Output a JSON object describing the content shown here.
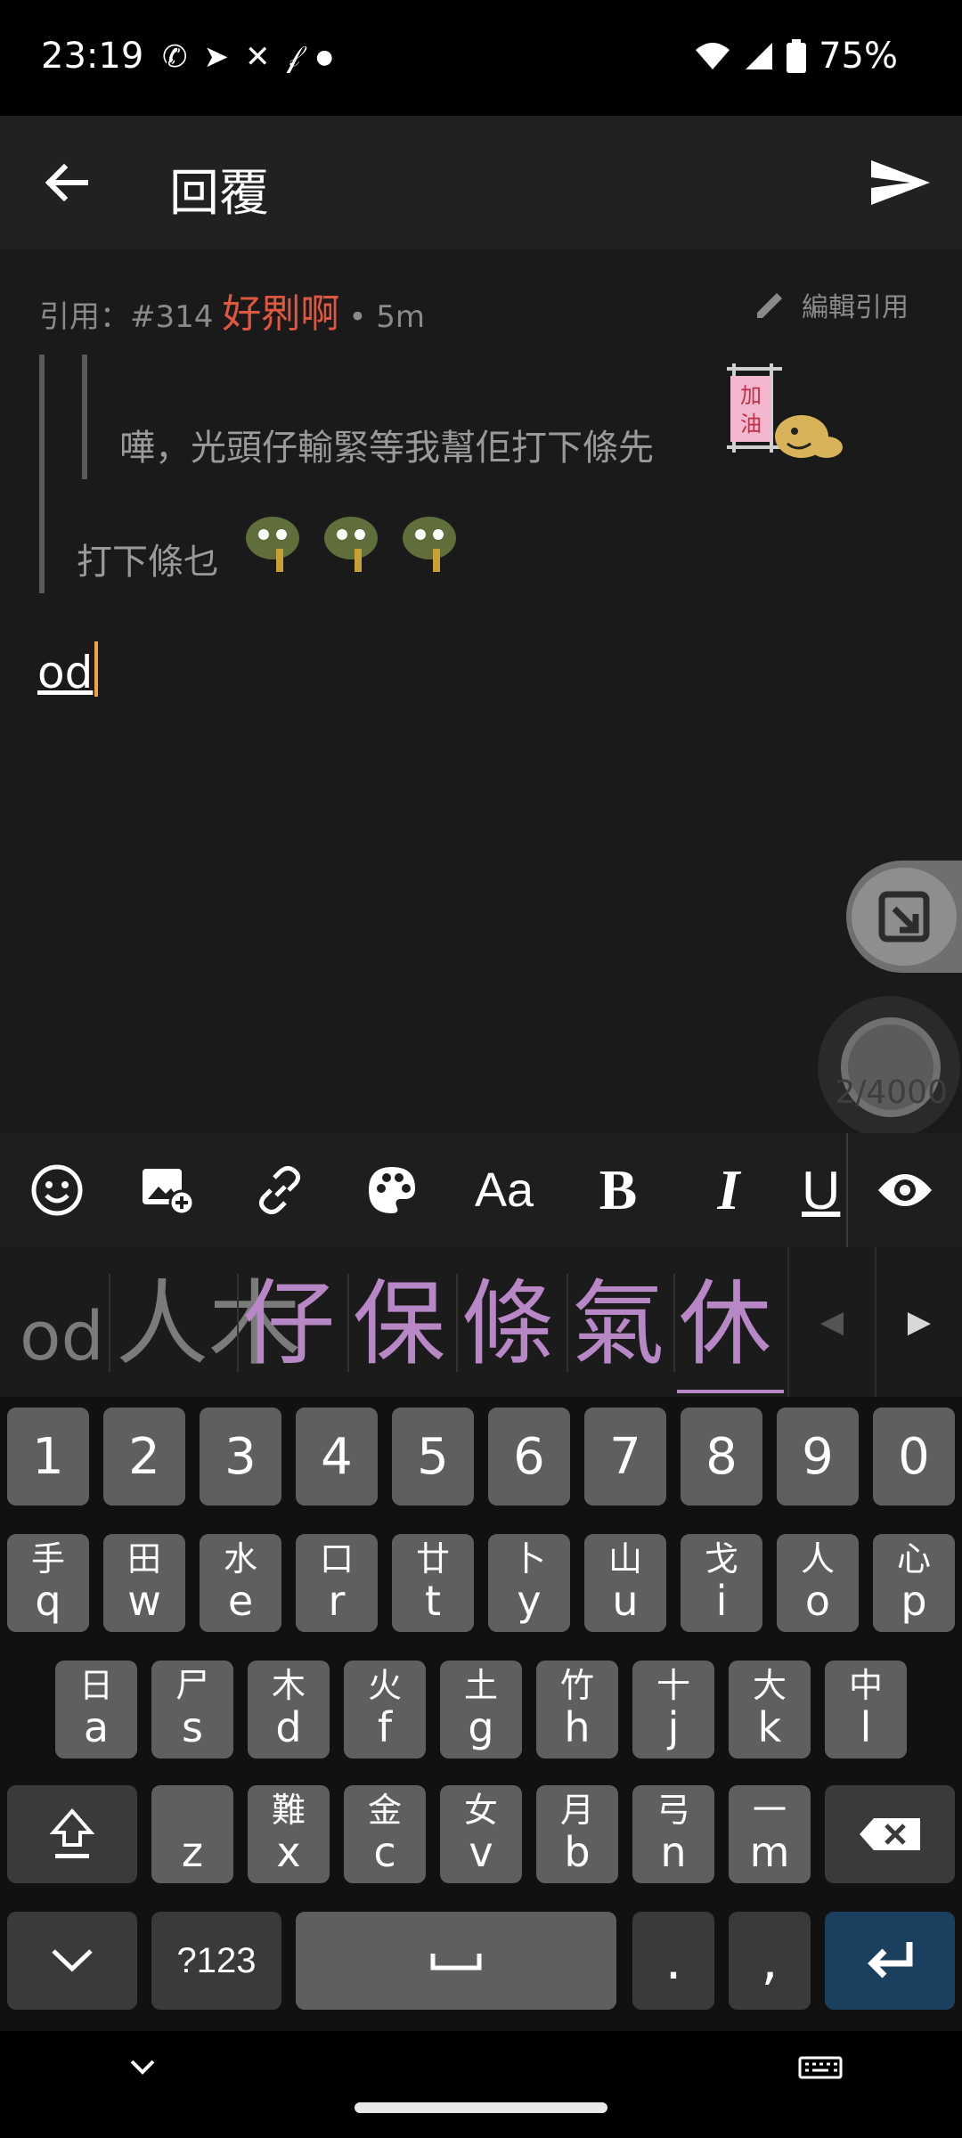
{
  "status_bar": {
    "time": "23:19",
    "notification_icons": [
      "whatsapp-icon",
      "telegram-icon",
      "app-icon",
      "app-icon",
      "dot-icon"
    ],
    "battery": "75%"
  },
  "app_bar": {
    "title": "回覆"
  },
  "quote": {
    "prefix": "引用：#314",
    "user": "好𠝹啊",
    "time": "• 5m",
    "edit_label": "編輯引用",
    "nested_text": "嘩，光頭仔輸緊等我幫佢打下條先",
    "text": "打下條乜",
    "sticker_sign": "加油"
  },
  "editor": {
    "value": "od",
    "char_count": "2/4000"
  },
  "format_toolbar": {
    "items": [
      "emoji-icon",
      "add-image-icon",
      "link-icon",
      "palette-icon",
      "text-size-icon",
      "bold-icon",
      "italic-icon",
      "underline-icon",
      "preview-eye-icon"
    ],
    "bold": "B",
    "italic": "I",
    "underline": "U",
    "text_size": "Aa"
  },
  "candidates": {
    "composing": "od",
    "items": [
      "人木",
      "仔",
      "保",
      "條",
      "氣",
      "休"
    ]
  },
  "keyboard": {
    "numbers": [
      "1",
      "2",
      "3",
      "4",
      "5",
      "6",
      "7",
      "8",
      "9",
      "0"
    ],
    "row1": [
      [
        "手",
        "q"
      ],
      [
        "田",
        "w"
      ],
      [
        "水",
        "e"
      ],
      [
        "口",
        "r"
      ],
      [
        "廿",
        "t"
      ],
      [
        "卜",
        "y"
      ],
      [
        "山",
        "u"
      ],
      [
        "戈",
        "i"
      ],
      [
        "人",
        "o"
      ],
      [
        "心",
        "p"
      ]
    ],
    "row2": [
      [
        "日",
        "a"
      ],
      [
        "尸",
        "s"
      ],
      [
        "木",
        "d"
      ],
      [
        "火",
        "f"
      ],
      [
        "土",
        "g"
      ],
      [
        "竹",
        "h"
      ],
      [
        "十",
        "j"
      ],
      [
        "大",
        "k"
      ],
      [
        "中",
        "l"
      ]
    ],
    "row3": [
      [
        "",
        "z"
      ],
      [
        "難",
        "x"
      ],
      [
        "金",
        "c"
      ],
      [
        "女",
        "v"
      ],
      [
        "月",
        "b"
      ],
      [
        "弓",
        "n"
      ],
      [
        "一",
        "m"
      ]
    ],
    "symbols_label": "?123",
    "period": ".",
    "comma": ","
  }
}
